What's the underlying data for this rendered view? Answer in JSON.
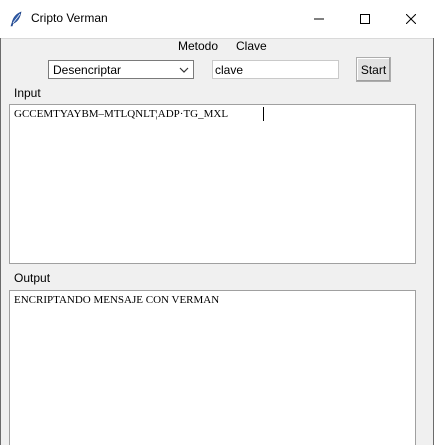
{
  "window": {
    "title": "Cripto Verman",
    "icon": "feather-icon",
    "controls": [
      "minimize-icon",
      "maximize-icon",
      "close-icon"
    ]
  },
  "header": {
    "method_label": "Metodo",
    "key_label": "Clave"
  },
  "controls": {
    "method_selected": "Desencriptar",
    "key_value": "clave",
    "start_label": "Start"
  },
  "input": {
    "label": "Input",
    "text": "GCCEMTYAYBM–MTLQNLT¦ADP·TG_MXL"
  },
  "output": {
    "label": "Output",
    "text": "ENCRIPTANDO MENSAJE CON VERMAN"
  }
}
